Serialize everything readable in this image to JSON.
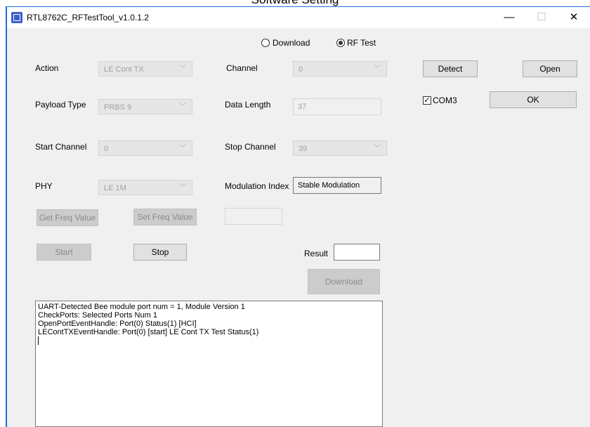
{
  "doc_title": "Software Setting",
  "window": {
    "title": "RTL8762C_RFTestTool_v1.0.1.2",
    "minimize": "—",
    "maximize": "☐",
    "close": "✕"
  },
  "mode": {
    "options": [
      "Download",
      "RF Test"
    ],
    "selected": "RF Test"
  },
  "form": {
    "action": {
      "label": "Action",
      "value": "LE Cont TX"
    },
    "channel": {
      "label": "Channel",
      "value": "0"
    },
    "payload_type": {
      "label": "Payload Type",
      "value": "PRBS 9"
    },
    "data_length": {
      "label": "Data Length",
      "value": "37"
    },
    "start_channel": {
      "label": "Start Channel",
      "value": "0"
    },
    "stop_channel": {
      "label": "Stop Channel",
      "value": "39"
    },
    "phy": {
      "label": "PHY",
      "value": "LE 1M"
    },
    "modulation_index": {
      "label": "Modulation Index",
      "value": "Stable Modulation"
    },
    "freq_value": ""
  },
  "buttons": {
    "get_freq": "Get Freq Value",
    "set_freq": "Set Freq Value",
    "start": "Start",
    "stop": "Stop",
    "download": "Download",
    "detect": "Detect",
    "open": "Open",
    "ok": "OK"
  },
  "result": {
    "label": "Result",
    "value": ""
  },
  "ports": [
    {
      "label": "COM3",
      "checked": true
    }
  ],
  "log": [
    "UART-Detected Bee module port num = 1, Module Version 1",
    "CheckPorts: Selected Ports Num 1",
    "OpenPortEventHandle: Port(0) Status(1) [HCI]",
    "LEContTXEventHandle: Port(0) [start] LE Cont TX Test Status(1)"
  ],
  "icons": {
    "chevron": "chevron-down-icon",
    "check": "checkmark-icon"
  }
}
